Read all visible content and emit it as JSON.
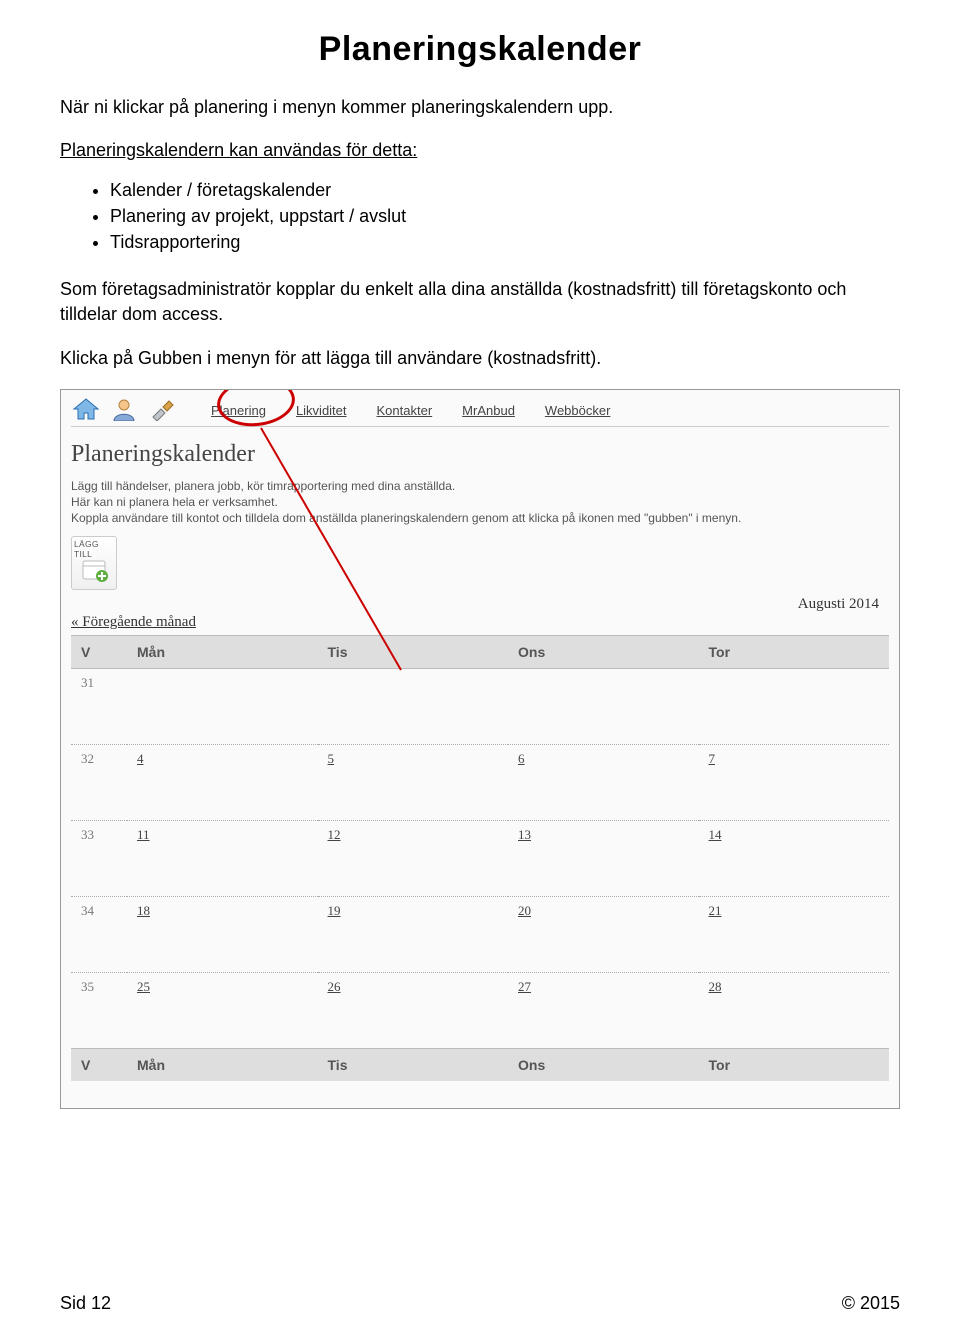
{
  "title": "Planeringskalender",
  "intro": "När ni klickar på planering i menyn kommer planeringskalendern upp.",
  "subhead": "Planeringskalendern kan användas för detta:",
  "bullets": [
    "Kalender / företagskalender",
    "Planering av projekt, uppstart / avslut",
    "Tidsrapportering"
  ],
  "para1": "Som företagsadministratör kopplar du enkelt alla dina anställda (kostnadsfritt) till företagskonto och tilldelar dom access.",
  "para2": "Klicka på Gubben i menyn för att lägga till användare (kostnadsfritt).",
  "screenshot": {
    "menu": [
      "Planering",
      "Likviditet",
      "Kontakter",
      "MrAnbud",
      "Webböcker"
    ],
    "heading": "Planeringskalender",
    "desc_lines": [
      "Lägg till händelser, planera jobb, kör timrapportering med dina anställda.",
      "Här kan ni planera hela er verksamhet.",
      "Koppla användare till kontot och tilldela dom anställda planeringskalendern genom att klicka på ikonen med \"gubben\" i menyn."
    ],
    "add_label": "LÄGG TILL",
    "prev_label": "« Föregående månad",
    "month": "Augusti 2014",
    "headers": [
      "V",
      "Mån",
      "Tis",
      "Ons",
      "Tor"
    ],
    "rows": [
      {
        "week": "31",
        "cells": [
          "",
          "",
          "",
          ""
        ]
      },
      {
        "week": "32",
        "cells": [
          "4",
          "5",
          "6",
          "7"
        ]
      },
      {
        "week": "33",
        "cells": [
          "11",
          "12",
          "13",
          "14"
        ]
      },
      {
        "week": "34",
        "cells": [
          "18",
          "19",
          "20",
          "21"
        ]
      },
      {
        "week": "35",
        "cells": [
          "25",
          "26",
          "27",
          "28"
        ]
      }
    ]
  },
  "footer": {
    "left": "Sid 12",
    "right": "© 2015"
  }
}
